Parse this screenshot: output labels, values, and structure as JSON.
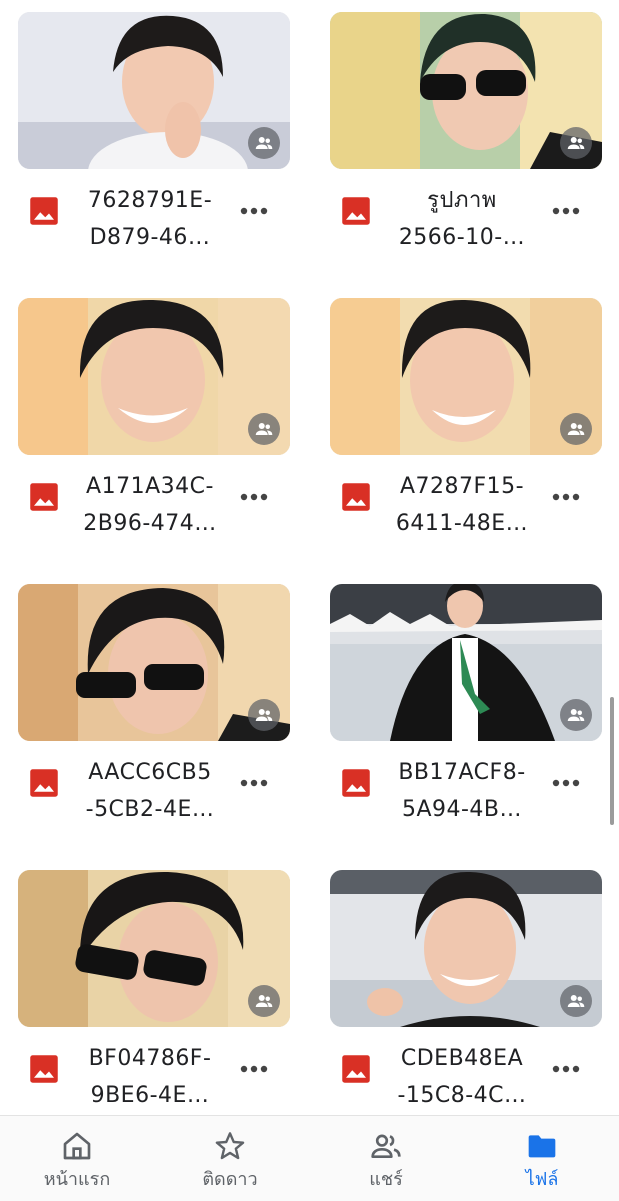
{
  "files": [
    {
      "name_line1": "7628791E-",
      "name_line2": "D879-46…",
      "type_icon": "image-file-icon",
      "shared": true
    },
    {
      "name_line1": "รูปภาพ",
      "name_line2": "2566-10-…",
      "type_icon": "image-file-icon",
      "shared": true
    },
    {
      "name_line1": "A171A34C-",
      "name_line2": "2B96-474…",
      "type_icon": "image-file-icon",
      "shared": true
    },
    {
      "name_line1": "A7287F15-",
      "name_line2": "6411-48E…",
      "type_icon": "image-file-icon",
      "shared": true
    },
    {
      "name_line1": "AACC6CB5",
      "name_line2": "-5CB2-4E…",
      "type_icon": "image-file-icon",
      "shared": true
    },
    {
      "name_line1": "BB17ACF8-",
      "name_line2": "5A94-4B…",
      "type_icon": "image-file-icon",
      "shared": true
    },
    {
      "name_line1": "BF04786F-",
      "name_line2": "9BE6-4E…",
      "type_icon": "image-file-icon",
      "shared": true
    },
    {
      "name_line1": "CDEB48EA",
      "name_line2": "-15C8-4C…",
      "type_icon": "image-file-icon",
      "shared": true
    }
  ],
  "bottom_nav": [
    {
      "label": "หน้าแรก",
      "icon": "home-icon",
      "active": false
    },
    {
      "label": "ติดดาว",
      "icon": "star-icon",
      "active": false
    },
    {
      "label": "แชร์",
      "icon": "people-icon",
      "active": false
    },
    {
      "label": "ไฟล์",
      "icon": "folder-icon",
      "active": true
    }
  ],
  "colors": {
    "accent": "#1a73e8",
    "image_icon": "#d93025",
    "inactive": "#5f6368",
    "badge": "#5f6368"
  }
}
